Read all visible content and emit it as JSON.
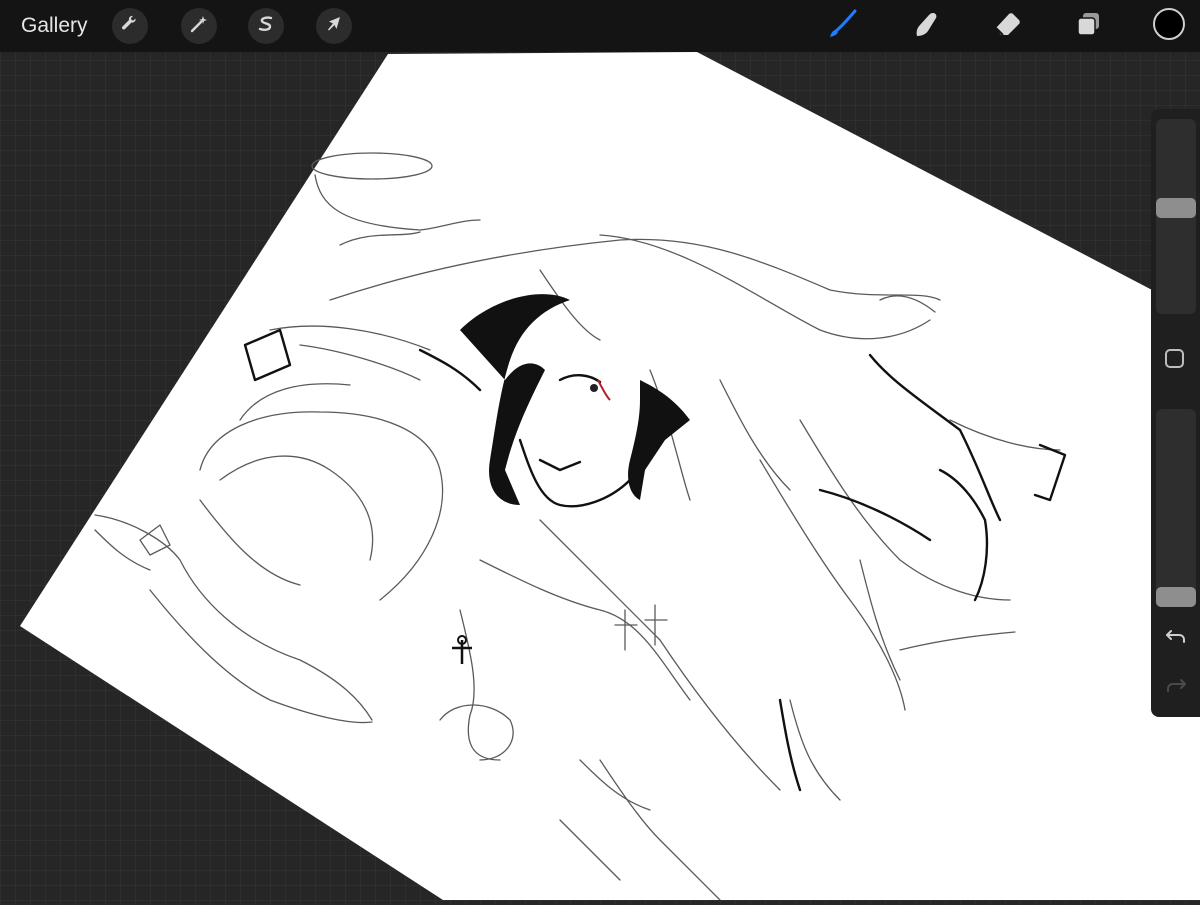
{
  "app": {
    "gallery_label": "Gallery",
    "accent_color": "#1f7cff",
    "current_color": "#000000"
  },
  "toolbar_left": [
    {
      "name": "actions-tool",
      "icon": "wrench-icon"
    },
    {
      "name": "adjustments-tool",
      "icon": "magic-wand-icon"
    },
    {
      "name": "selection-tool",
      "icon": "selection-s-icon"
    },
    {
      "name": "transform-tool",
      "icon": "arrow-cursor-icon"
    }
  ],
  "toolbar_right": [
    {
      "name": "brush-tool",
      "icon": "brush-icon",
      "active": true
    },
    {
      "name": "smudge-tool",
      "icon": "smudge-finger-icon"
    },
    {
      "name": "eraser-tool",
      "icon": "eraser-icon"
    },
    {
      "name": "layers-tool",
      "icon": "layers-icon"
    }
  ],
  "sidebar": {
    "brush_size_level": 0.55,
    "opacity_level": 0.0,
    "modify_button_icon": "square-icon",
    "undo_icon": "undo-icon",
    "redo_icon": "redo-icon"
  }
}
